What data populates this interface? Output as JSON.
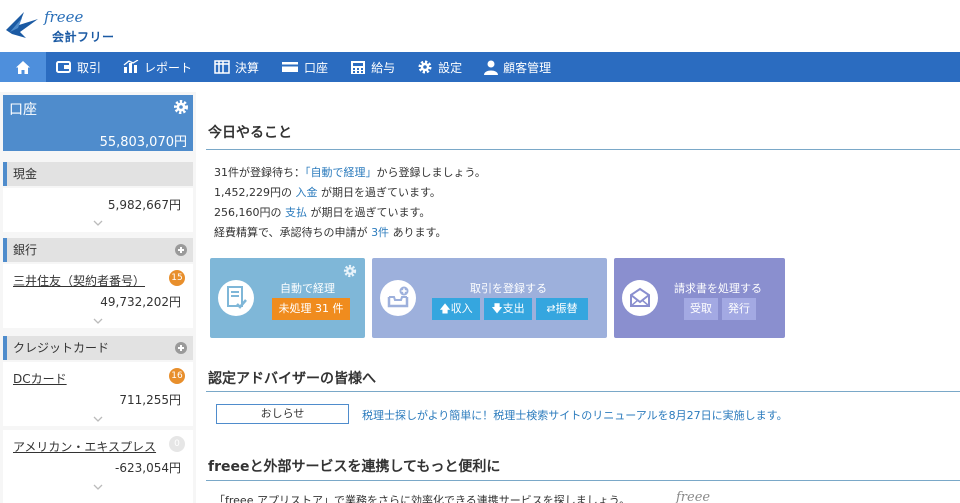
{
  "logo": {
    "script": "freee",
    "name": "会計フリー"
  },
  "nav": {
    "items": [
      {
        "icon": "wallet-icon",
        "label": "取引"
      },
      {
        "icon": "report-icon",
        "label": "レポート"
      },
      {
        "icon": "settlement-icon",
        "label": "決算"
      },
      {
        "icon": "card-icon",
        "label": "口座"
      },
      {
        "icon": "calculator-icon",
        "label": "給与"
      },
      {
        "icon": "gear-icon",
        "label": "設定"
      },
      {
        "icon": "person-icon",
        "label": "顧客管理"
      }
    ]
  },
  "sidebar": {
    "title": "口座",
    "total": "55,803,070円",
    "cash": {
      "label": "現金",
      "amount": "5,982,667円"
    },
    "bank": {
      "label": "銀行",
      "account": "三井住友（契約者番号）",
      "amount": "49,732,202円",
      "badge": "15"
    },
    "credit": {
      "label": "クレジットカード",
      "accounts": [
        {
          "name": "DCカード",
          "amount": "711,255円",
          "badge": "16"
        },
        {
          "name": "アメリカン・エキスプレス",
          "amount": "-623,054円",
          "badge": "0"
        }
      ]
    }
  },
  "main": {
    "todo_title": "今日やること",
    "tasks": [
      {
        "pre": "31件が登録待ち：",
        "link": "「自動で経理」",
        "post": "から登録しましょう。"
      },
      {
        "pre": "1,452,229円の",
        "link": "入金",
        "post": "が期日を過ぎています。"
      },
      {
        "pre": "256,160円の",
        "link": "支払",
        "post": "が期日を過ぎています。"
      },
      {
        "pre": "経費精算で、承認待ちの申請が",
        "link": "3件",
        "post": "あります。"
      }
    ],
    "cards": {
      "auto": {
        "title": "自動で経理",
        "button": "未処理 31 件"
      },
      "register": {
        "title": "取引を登録する",
        "income": "収入",
        "expense": "支出",
        "transfer": "振替"
      },
      "invoice": {
        "title": "請求書を処理する",
        "receive": "受取",
        "issue": "発行"
      }
    },
    "advisor_title": "認定アドバイザーの皆様へ",
    "notice_label": "おしらせ",
    "notice_text": "税理士探しがより簡単に！税理士検索サイトのリニューアルを8月27日に実施します。",
    "integration_title": "freeeと外部サービスを連携してもっと便利に",
    "integration_text": "「freee アプリストア」で業務をさらに効率化できる連携サービスを探しましょう。",
    "integration_logo": "freee"
  },
  "colors": {
    "nav": "#2b6cc0",
    "accent": "#4f8ccc",
    "orange": "#f08c1e",
    "link": "#2b7bbd"
  }
}
